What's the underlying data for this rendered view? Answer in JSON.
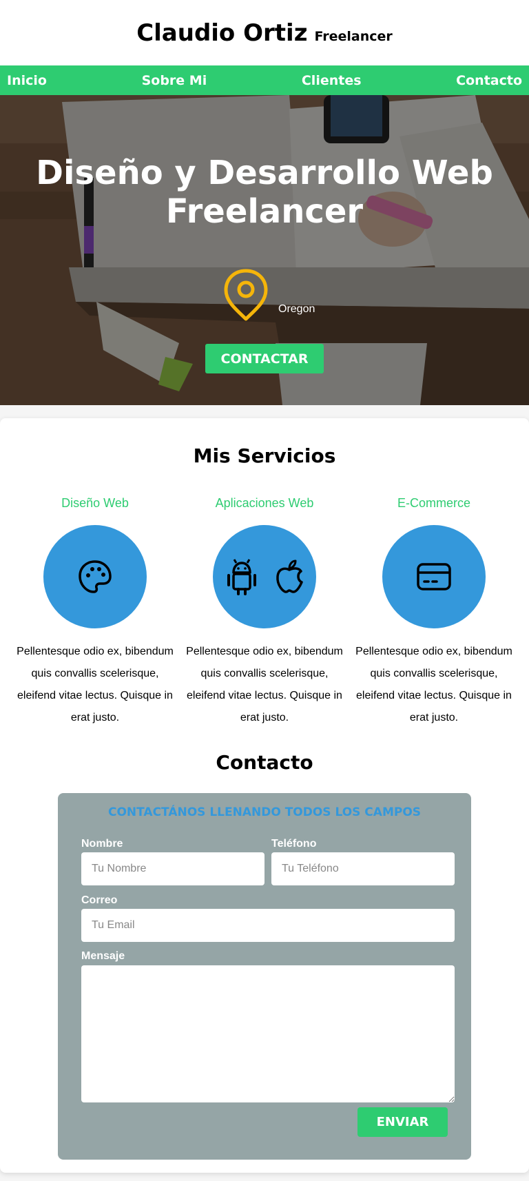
{
  "header": {
    "name": "Claudio Ortiz",
    "subtitle": "Freelancer"
  },
  "nav": {
    "items": [
      "Inicio",
      "Sobre Mi",
      "Clientes",
      "Contacto"
    ]
  },
  "hero": {
    "title": "Diseño y Desarrollo Web Freelancer",
    "location": "Oregon",
    "button": "CONTACTAR"
  },
  "services": {
    "title": "Mis Servicios",
    "items": [
      {
        "title": "Diseño Web",
        "icon": "palette-icon",
        "text": "Pellentesque odio ex, bibendum quis convallis scelerisque, eleifend vitae lectus. Quisque in erat justo."
      },
      {
        "title": "Aplicaciones Web",
        "icon": "android-apple-icons",
        "text": "Pellentesque odio ex, bibendum quis convallis scelerisque, eleifend vitae lectus. Quisque in erat justo."
      },
      {
        "title": "E-Commerce",
        "icon": "credit-card-icon",
        "text": "Pellentesque odio ex, bibendum quis convallis scelerisque, eleifend vitae lectus. Quisque in erat justo."
      }
    ]
  },
  "contact": {
    "title": "Contacto",
    "form_heading": "CONTACTÁNOS LLENANDO TODOS LOS CAMPOS",
    "name_label": "Nombre",
    "name_placeholder": "Tu Nombre",
    "phone_label": "Teléfono",
    "phone_placeholder": "Tu Teléfono",
    "email_label": "Correo",
    "email_placeholder": "Tu Email",
    "message_label": "Mensaje",
    "message_placeholder": "",
    "submit": "ENVIAR"
  },
  "colors": {
    "accent_green": "#2ecc71",
    "accent_blue": "#3498db",
    "form_gray": "#95a5a6",
    "location_yellow": "#f5b50a"
  }
}
